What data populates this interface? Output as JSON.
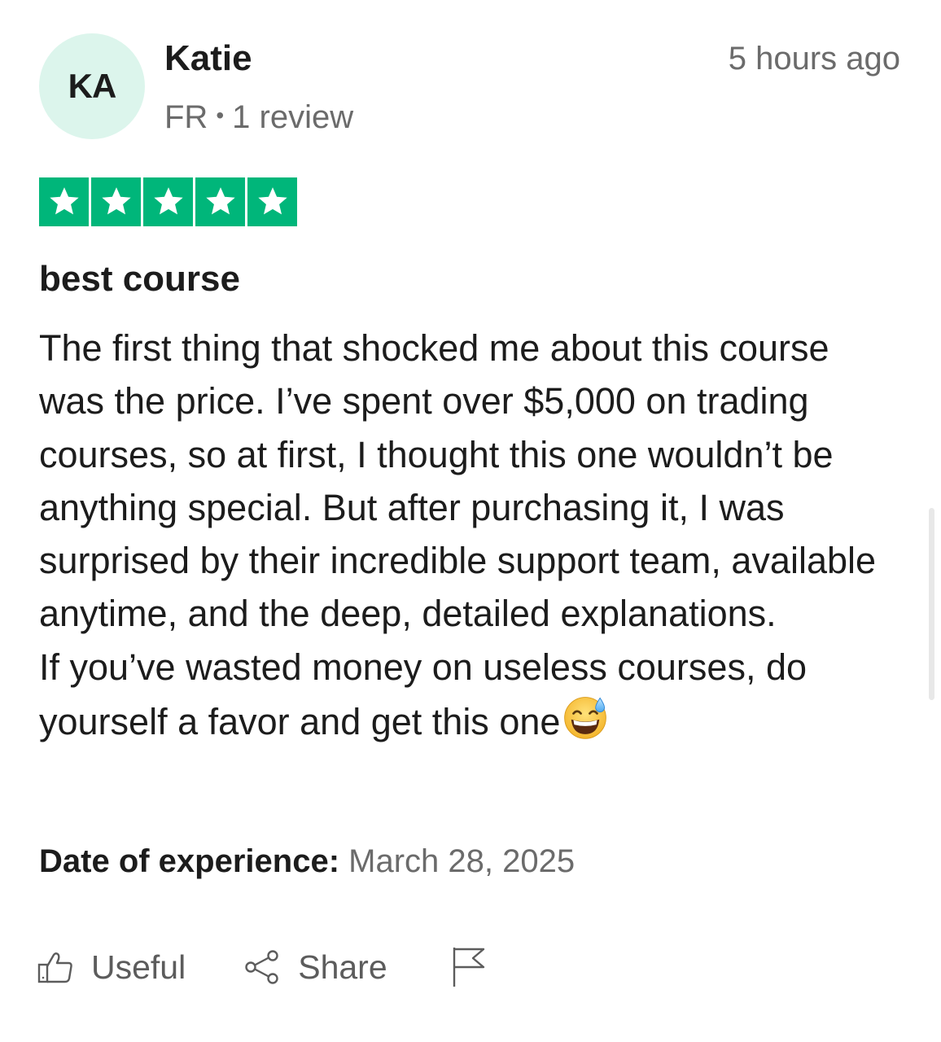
{
  "reviewer": {
    "initials": "KA",
    "name": "Katie",
    "country": "FR",
    "separator": "•",
    "review_count": "1 review"
  },
  "posted_time": "5 hours ago",
  "rating": {
    "stars": 5,
    "max_stars": 5,
    "color": "#00b67a"
  },
  "review": {
    "title": "best course",
    "paragraphs": [
      "The first thing that shocked me about this course was the price. I’ve spent over $5,000 on trading courses, so at first, I thought this one wouldn’t be anything special. But after purchasing it, I was surprised by their incredible support team, available anytime, and the deep, detailed explanations.",
      "If you’ve wasted money on useless courses, do yourself a favor and get this one"
    ],
    "trailing_emoji": "grinning-face-with-sweat-emoji"
  },
  "experience": {
    "label": "Date of experience:",
    "date": "March 28, 2025"
  },
  "actions": {
    "useful_label": "Useful",
    "share_label": "Share",
    "useful_icon": "thumbs-up-icon",
    "share_icon": "share-icon",
    "report_icon": "flag-icon"
  },
  "colors": {
    "avatar_bg": "#dcf5ec",
    "muted_text": "#6b6b6b",
    "star_green": "#00b67a"
  }
}
